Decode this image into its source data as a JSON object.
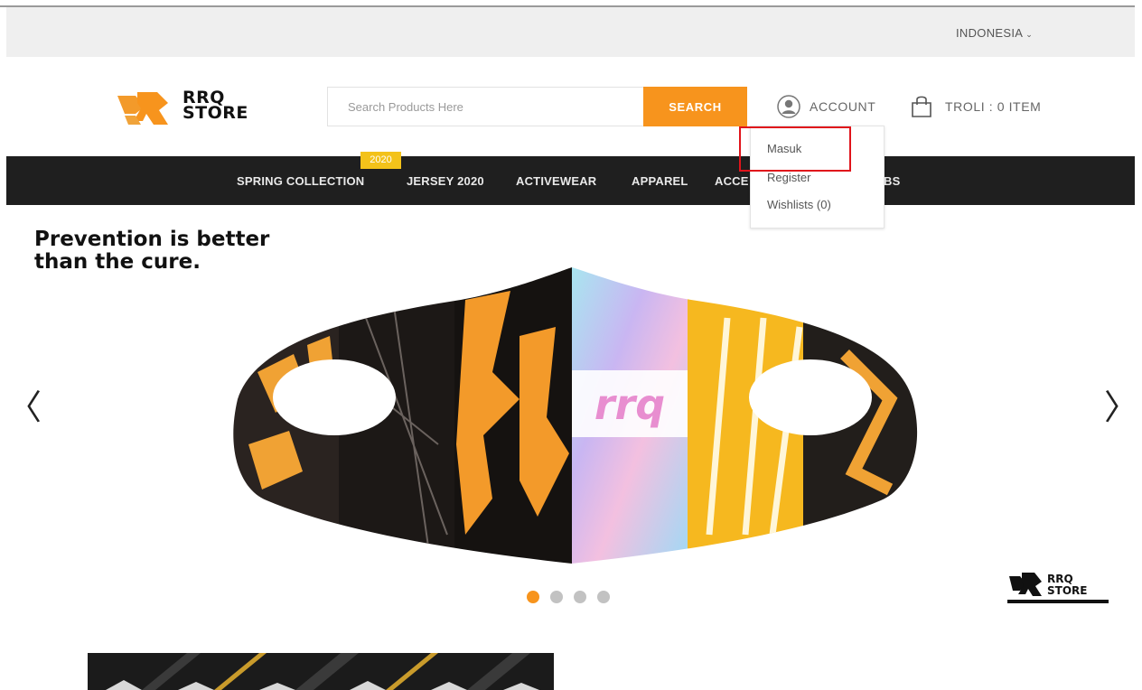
{
  "topbar": {
    "country": "INDONESIA"
  },
  "header": {
    "logo_line1": "RRQ",
    "logo_line2": "STORE",
    "search_placeholder": "Search Products Here",
    "search_button": "SEARCH",
    "account_label": "ACCOUNT",
    "cart_label": "TROLI : 0 ITEM"
  },
  "nav": {
    "items": [
      "SPRING COLLECTION",
      "JERSEY 2020",
      "ACTIVEWEAR",
      "APPAREL",
      "ACCE",
      "BS"
    ],
    "badge": "2020"
  },
  "account_menu": {
    "items": [
      "Masuk",
      "Register",
      "Wishlists (0)"
    ]
  },
  "hero": {
    "headline_line1": "Prevention is better",
    "headline_line2": "than the cure.",
    "mask_text": "rrq",
    "brand_line1": "RRQ",
    "brand_line2": "STORE",
    "arrow_left": "〈",
    "arrow_right": "〉",
    "slide_count": 4,
    "active_slide": 1
  },
  "colors": {
    "accent": "#f7941d",
    "nav_bg": "#1f1f1f",
    "badge": "#f3c21a",
    "highlight": "#e0141b"
  },
  "icons": [
    "chevron-down-icon",
    "user-icon",
    "shopping-bag-icon",
    "chevron-left-icon",
    "chevron-right-icon"
  ]
}
